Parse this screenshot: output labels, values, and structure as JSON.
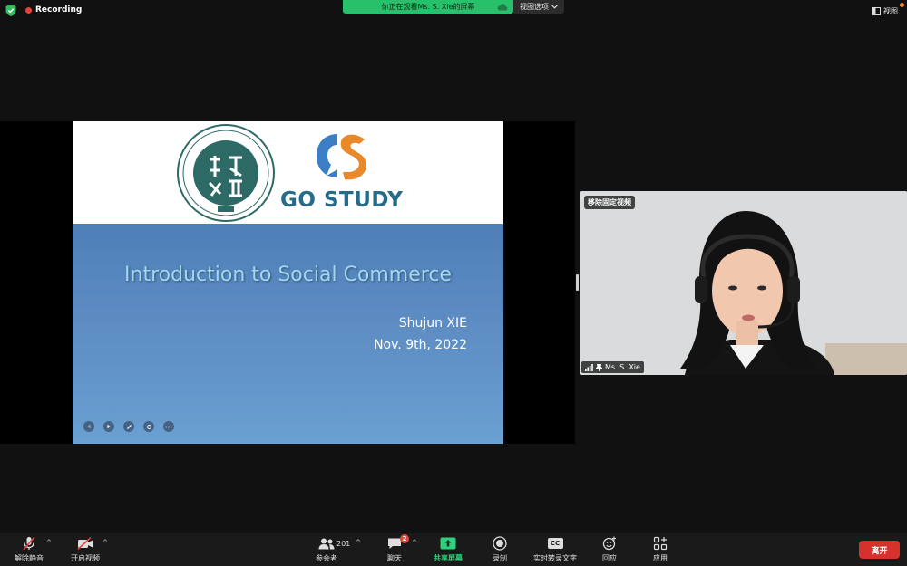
{
  "topbar": {
    "recording_label": "Recording",
    "share_banner_text": "你正在观看Ms. S. Xie的屏幕",
    "view_options_label": "视图选项",
    "view_label": "视图"
  },
  "slide": {
    "brand_text": "GO STUDY",
    "title": "Introduction to Social Commerce",
    "author": "Shujun XIE",
    "date": "Nov. 9th, 2022"
  },
  "video": {
    "pin_badge": "移除固定视频",
    "participant_name": "Ms. S. Xie"
  },
  "toolbar": {
    "unmute_label": "解除静音",
    "start_video_label": "开启视频",
    "participants_label": "参会者",
    "participants_count": "201",
    "chat_label": "聊天",
    "chat_badge": "2",
    "share_label": "共享屏幕",
    "record_label": "录制",
    "captions_label": "实时转录文字",
    "captions_icon_text": "CC",
    "reactions_label": "回应",
    "apps_label": "应用",
    "leave_label": "离开"
  },
  "colors": {
    "share_green": "#27c06b",
    "leave_red": "#d6312c",
    "record_red": "#e2433f",
    "slide_title": "#9fd9ef",
    "slide_bg": "#5e8ec4",
    "logo_orange": "#e8892c",
    "logo_blue": "#3b7ec6"
  }
}
